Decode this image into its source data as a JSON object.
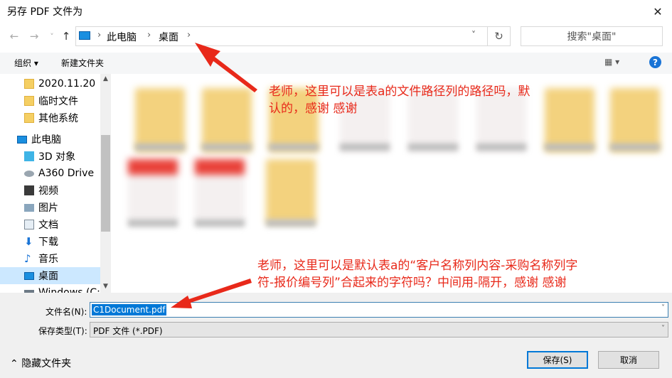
{
  "window": {
    "title": "另存 PDF 文件为",
    "close_glyph": "✕"
  },
  "nav_buttons": {
    "back": "←",
    "forward": "→",
    "recent": "˅",
    "up": "↑"
  },
  "address": {
    "crumbs": [
      "此电脑",
      "桌面"
    ],
    "separator": "›",
    "dropdown_glyph": "˅",
    "refresh_glyph": "↻"
  },
  "search": {
    "placeholder": "搜索\"桌面\""
  },
  "toolbar": {
    "organize": "组织 ▾",
    "new_folder": "新建文件夹",
    "view": "▦ ▾",
    "help": "?"
  },
  "navpane": {
    "items": [
      {
        "label": "2020.11.20",
        "icon": "folder-icon"
      },
      {
        "label": "临时文件",
        "icon": "folder-icon"
      },
      {
        "label": "其他系统",
        "icon": "folder-icon"
      },
      {
        "label": "此电脑",
        "icon": "computer-icon"
      },
      {
        "label": "3D 对象",
        "icon": "3d-objects-icon"
      },
      {
        "label": "A360 Drive",
        "icon": "cloud-drive-icon"
      },
      {
        "label": "视频",
        "icon": "video-icon"
      },
      {
        "label": "图片",
        "icon": "pictures-icon"
      },
      {
        "label": "文档",
        "icon": "documents-icon"
      },
      {
        "label": "下载",
        "icon": "download-icon"
      },
      {
        "label": "音乐",
        "icon": "music-icon"
      },
      {
        "label": "桌面",
        "icon": "desktop-icon"
      },
      {
        "label": "Windows (C:",
        "icon": "drive-icon"
      }
    ],
    "selected": "桌面"
  },
  "form": {
    "filename_label": "文件名(N):",
    "filename_value": "C1Document.pdf",
    "type_label": "保存类型(T):",
    "type_value": "PDF 文件 (*.PDF)",
    "hide_folders": "隐藏文件夹",
    "save": "保存(S)",
    "cancel": "取消"
  },
  "annotations": {
    "note1": "老师，这里可以是表a的文件路径列的路径吗，默认的，感谢 感谢",
    "note2": "老师，这里可以是默认表a的“客户名称列内容-采购名称列字符-报价编号列”合起来的字符吗？中间用-隔开，感谢 感谢",
    "color": "#e8291a"
  }
}
